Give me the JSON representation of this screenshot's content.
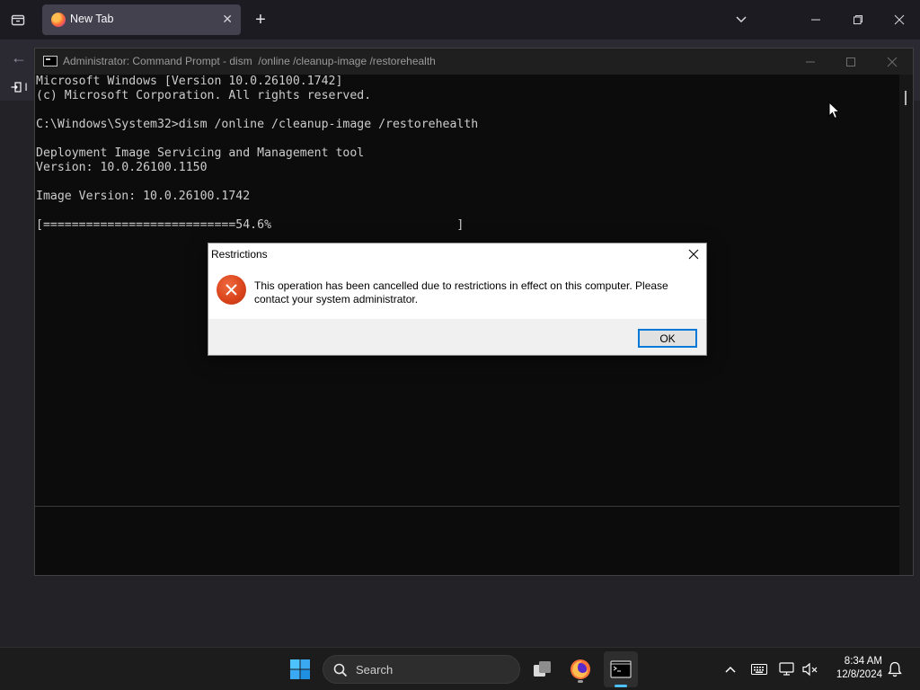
{
  "browser": {
    "tab_title": "New Tab",
    "tab_close": "✕",
    "new_tab": "+",
    "back": "←",
    "bookmarks_import_label": "I"
  },
  "cmd": {
    "title": "Administrator: Command Prompt - dism  /online /cleanup-image /restorehealth",
    "lines": [
      "Microsoft Windows [Version 10.0.26100.1742]",
      "(c) Microsoft Corporation. All rights reserved.",
      "",
      "C:\\Windows\\System32>dism /online /cleanup-image /restorehealth",
      "",
      "Deployment Image Servicing and Management tool",
      "Version: 10.0.26100.1150",
      "",
      "Image Version: 10.0.26100.1742",
      "",
      "[===========================54.6%                          ]"
    ],
    "progress_percent": 54.6
  },
  "dialog": {
    "title": "Restrictions",
    "message": "This operation has been cancelled due to restrictions in effect on this computer. Please contact your system administrator.",
    "ok_label": "OK",
    "icon": "error-icon"
  },
  "taskbar": {
    "search_label": "Search",
    "time": "8:34 AM",
    "date": "12/8/2024",
    "pinned": [
      "start-icon",
      "task-view-icon",
      "firefox-icon",
      "terminal-icon"
    ],
    "tray": [
      "chevron-up-icon",
      "keyboard-icon",
      "network-icon",
      "volume-muted-icon",
      "notification-bell-icon"
    ]
  },
  "colors": {
    "accent": "#0078d7",
    "error": "#d8421a",
    "console_text": "#cccccc",
    "active_indicator": "#4cc2ff"
  }
}
